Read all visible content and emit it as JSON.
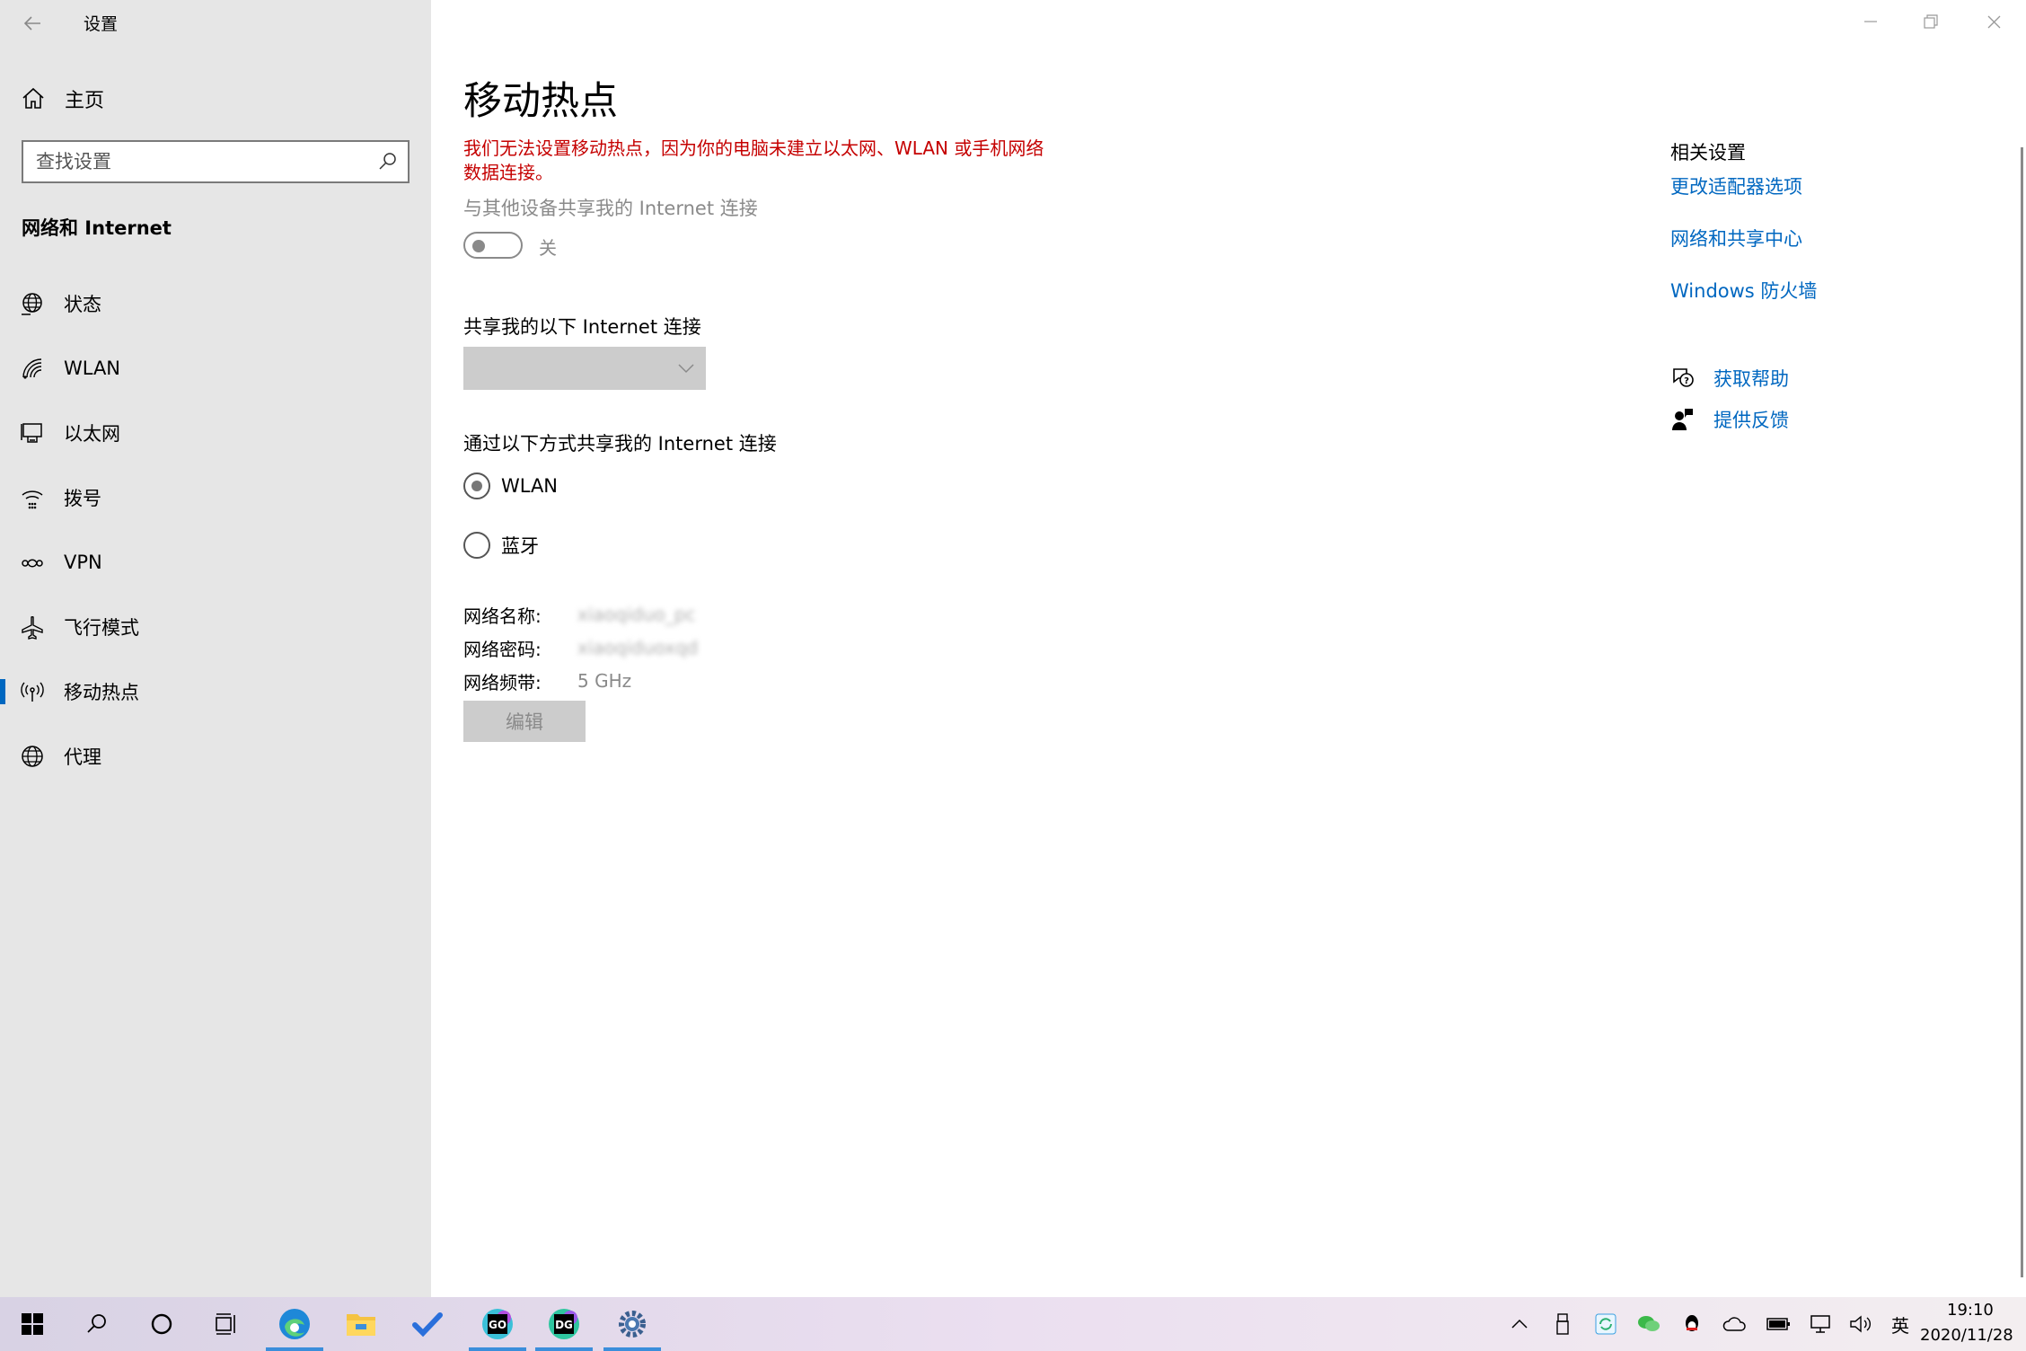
{
  "window": {
    "app_title": "设置",
    "back_glyph": "←"
  },
  "sidebar": {
    "home_label": "主页",
    "search_placeholder": "查找设置",
    "section_title": "网络和 Internet",
    "items": [
      {
        "label": "状态",
        "icon": "globe-status-icon"
      },
      {
        "label": "WLAN",
        "icon": "wifi-icon"
      },
      {
        "label": "以太网",
        "icon": "ethernet-icon"
      },
      {
        "label": "拨号",
        "icon": "dialup-icon"
      },
      {
        "label": "VPN",
        "icon": "vpn-icon"
      },
      {
        "label": "飞行模式",
        "icon": "airplane-icon"
      },
      {
        "label": "移动热点",
        "icon": "hotspot-icon",
        "active": true
      },
      {
        "label": "代理",
        "icon": "globe-icon"
      }
    ]
  },
  "main": {
    "title": "移动热点",
    "error_message": "我们无法设置移动热点，因为你的电脑未建立以太网、WLAN 或手机网络数据连接。",
    "share_label": "与其他设备共享我的 Internet 连接",
    "toggle_state": "关",
    "toggle_on": false,
    "share_from_label": "共享我的以下 Internet 连接",
    "share_from_value": "",
    "share_via_label": "通过以下方式共享我的 Internet 连接",
    "share_via_options": [
      {
        "label": "WLAN",
        "selected": true
      },
      {
        "label": "蓝牙",
        "selected": false
      }
    ],
    "network_name_label": "网络名称:",
    "network_name_value": "xiaoqiduo_pc",
    "network_password_label": "网络密码:",
    "network_password_value": "xiaoqiduoxqd",
    "network_band_label": "网络频带:",
    "network_band_value": "5 GHz",
    "edit_label": "编辑"
  },
  "related": {
    "title": "相关设置",
    "links": [
      "更改适配器选项",
      "网络和共享中心",
      "Windows 防火墙"
    ],
    "get_help": "获取帮助",
    "feedback": "提供反馈"
  },
  "taskbar": {
    "time": "19:10",
    "date": "2020/11/28",
    "ime": "英"
  },
  "colors": {
    "accent": "#0067c0",
    "error": "#c50000",
    "sidebar_bg": "#e6e6e6",
    "disabled": "#8a8a8a"
  }
}
